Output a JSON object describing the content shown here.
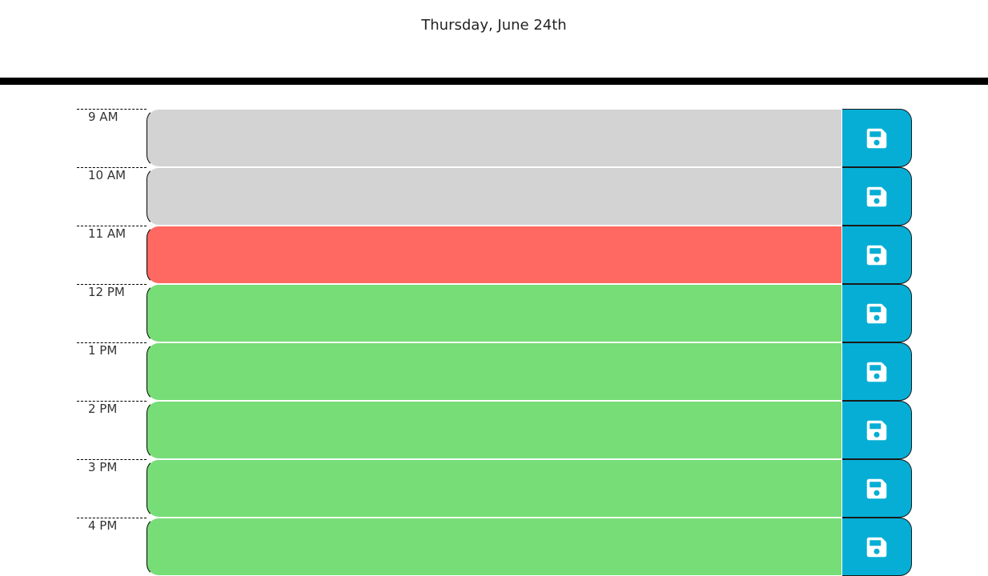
{
  "header": {
    "current_day": "Thursday, June 24th"
  },
  "colors": {
    "past": "#d3d3d3",
    "present": "#ff6961",
    "future": "#77dd77",
    "save": "#06aed5"
  },
  "icons": {
    "save": "floppy-disk-icon"
  },
  "timeblocks": [
    {
      "hour": "9 AM",
      "status": "past",
      "text": ""
    },
    {
      "hour": "10 AM",
      "status": "past",
      "text": ""
    },
    {
      "hour": "11 AM",
      "status": "present",
      "text": ""
    },
    {
      "hour": "12 PM",
      "status": "future",
      "text": ""
    },
    {
      "hour": "1 PM",
      "status": "future",
      "text": ""
    },
    {
      "hour": "2 PM",
      "status": "future",
      "text": ""
    },
    {
      "hour": "3 PM",
      "status": "future",
      "text": ""
    },
    {
      "hour": "4 PM",
      "status": "future",
      "text": ""
    }
  ]
}
